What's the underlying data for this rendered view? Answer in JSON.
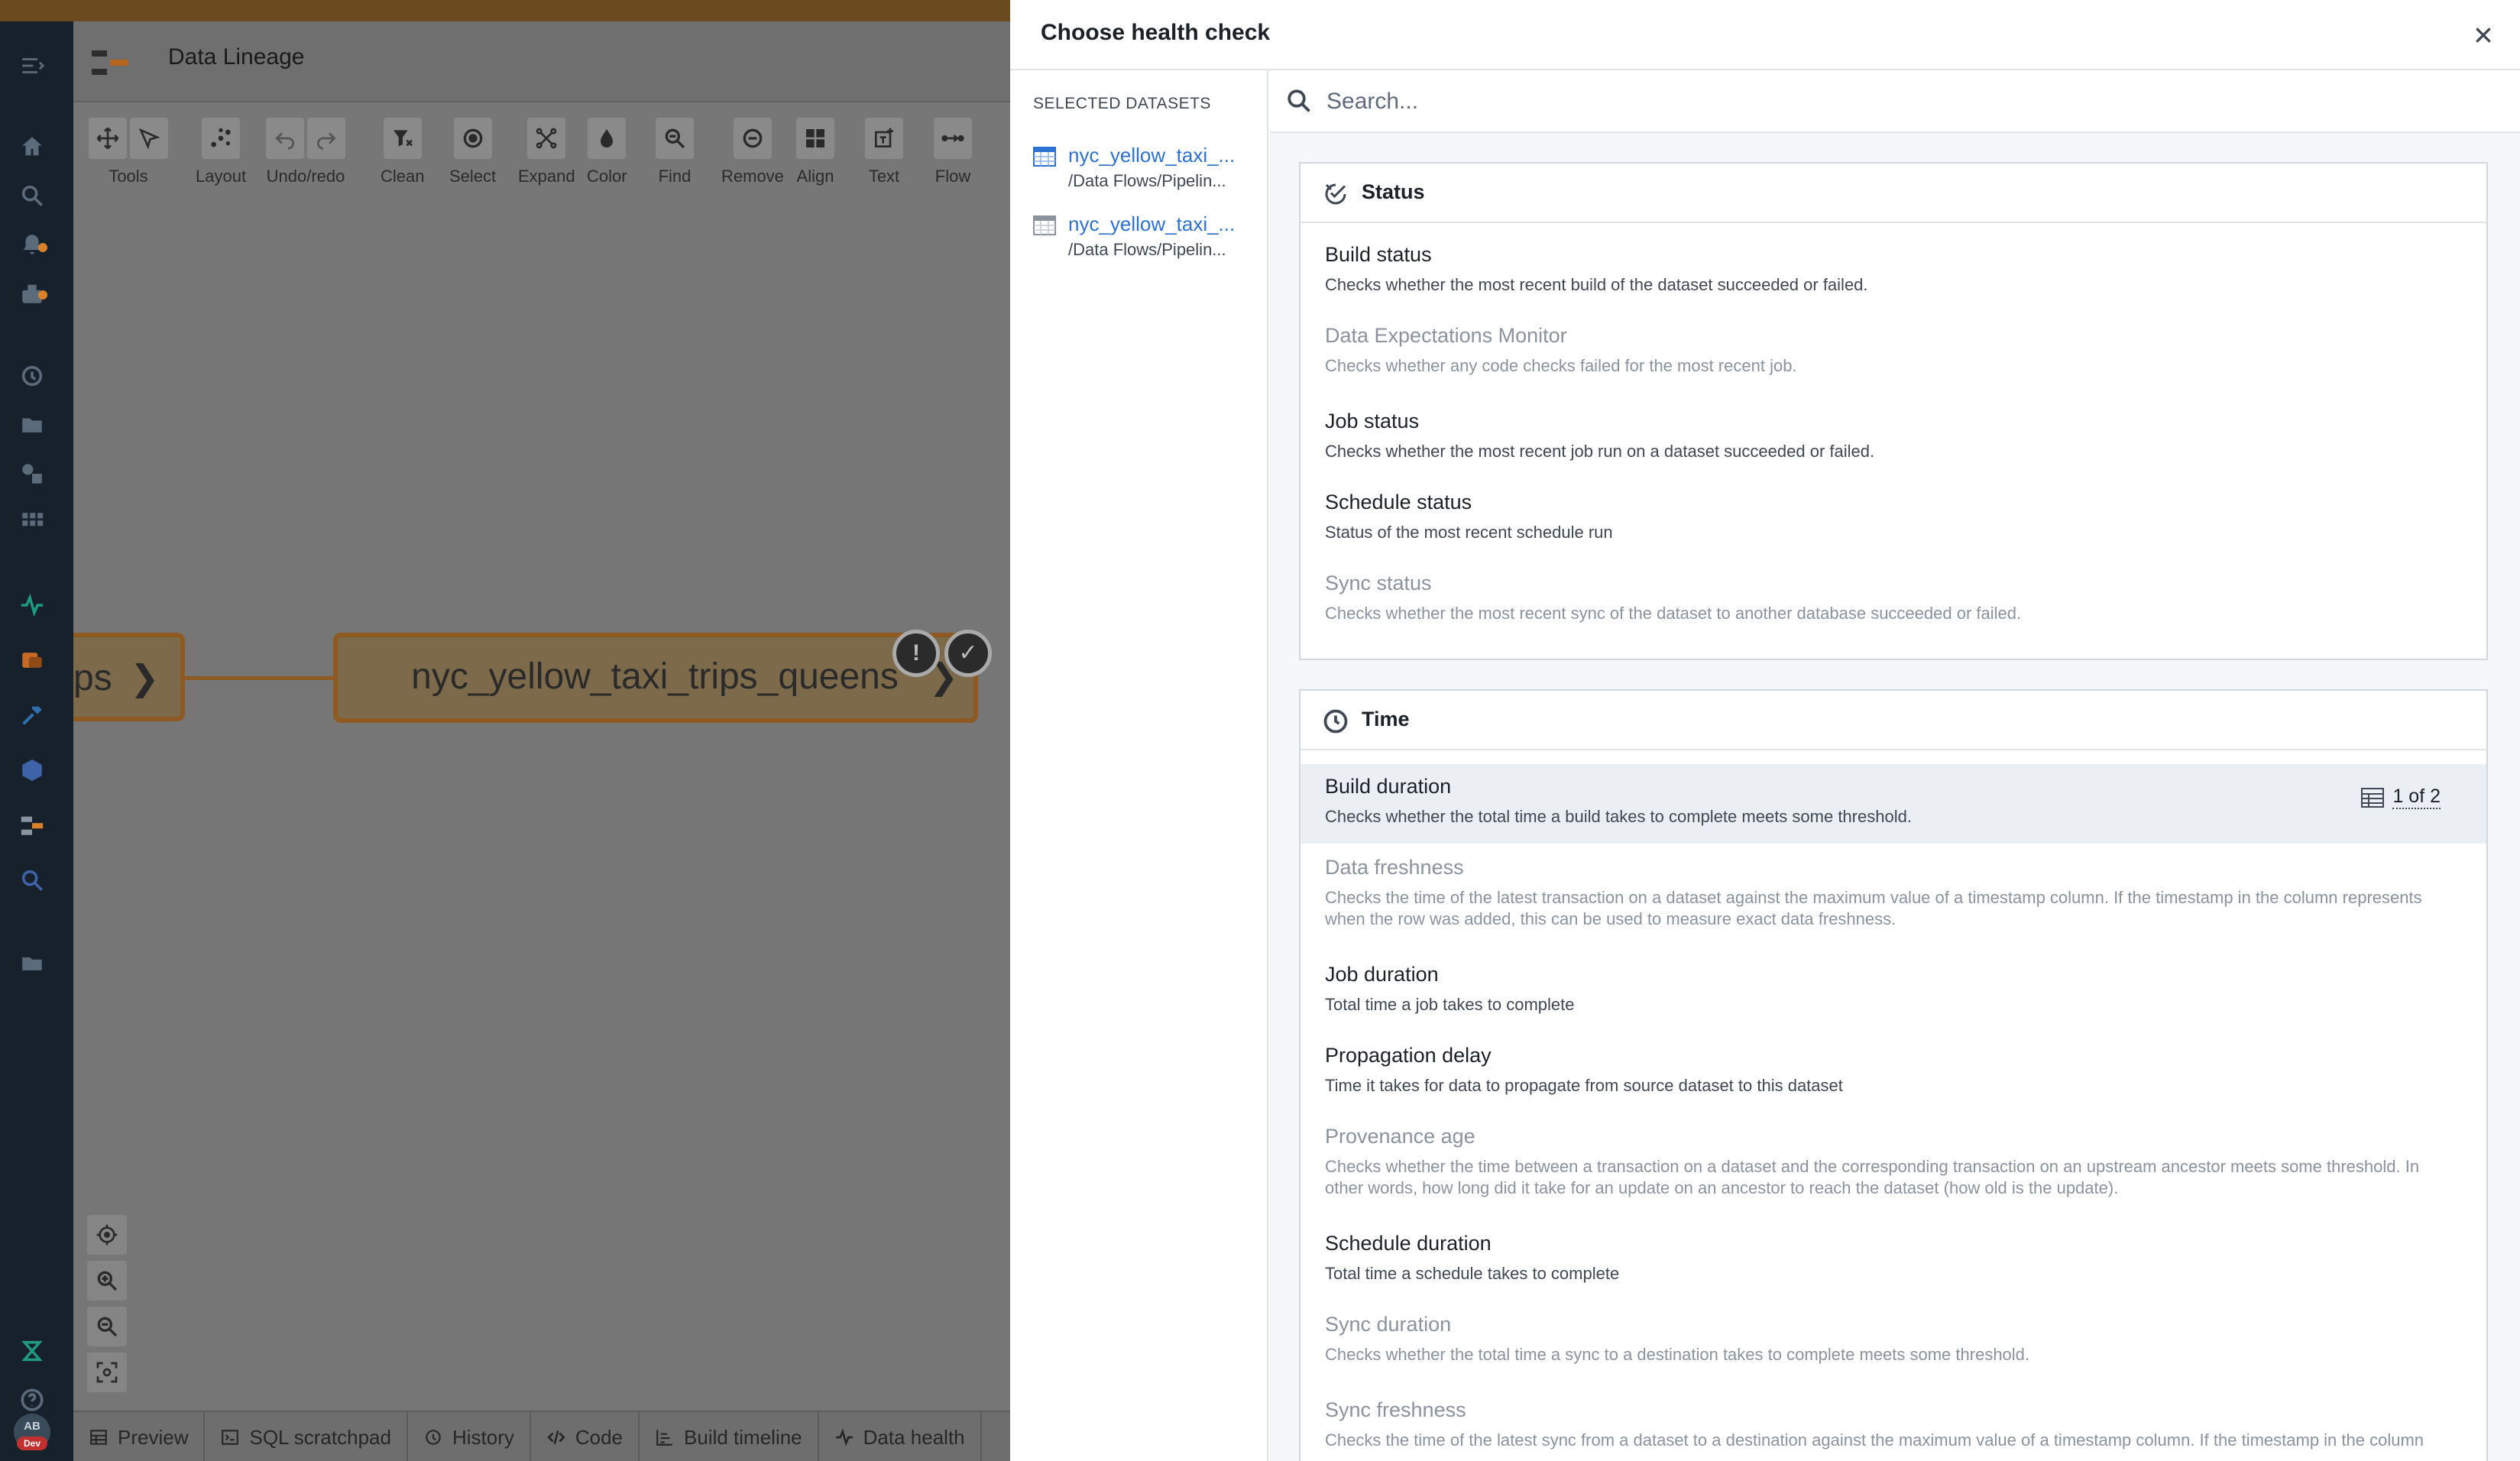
{
  "app": {
    "title": "Data Lineage"
  },
  "toolbar": [
    {
      "label": "Tools",
      "icon": "move-icon"
    },
    {
      "label": "Layout",
      "icon": "layout-icon"
    },
    {
      "label": "Undo/redo",
      "icon": "undo-icon"
    },
    {
      "label": "Clean",
      "icon": "clean-icon"
    },
    {
      "label": "Select",
      "icon": "select-icon"
    },
    {
      "label": "Expand",
      "icon": "expand-icon"
    },
    {
      "label": "Color",
      "icon": "color-icon"
    },
    {
      "label": "Find",
      "icon": "find-icon"
    },
    {
      "label": "Remove",
      "icon": "remove-icon"
    },
    {
      "label": "Align",
      "icon": "align-icon"
    },
    {
      "label": "Text",
      "icon": "text-icon"
    },
    {
      "label": "Flow",
      "icon": "flow-icon"
    }
  ],
  "graph": {
    "prev_node_label": "ps",
    "main_node_label": "nyc_yellow_taxi_trips_queens",
    "badge_warning": "!",
    "badge_ok": "✓",
    "edge_color": "#8f5a22"
  },
  "bottom_tabs": [
    {
      "label": "Preview"
    },
    {
      "label": "SQL scratchpad"
    },
    {
      "label": "History"
    },
    {
      "label": "Code"
    },
    {
      "label": "Build timeline"
    },
    {
      "label": "Data health"
    }
  ],
  "user": {
    "initials": "AB",
    "env": "Dev"
  },
  "drawer": {
    "title": "Choose health check",
    "selected_heading": "SELECTED DATASETS",
    "datasets": [
      {
        "name": "nyc_yellow_taxi_...",
        "path": "/Data Flows/Pipelin..."
      },
      {
        "name": "nyc_yellow_taxi_...",
        "path": "/Data Flows/Pipelin..."
      }
    ],
    "search_placeholder": "Search...",
    "sections": {
      "status": {
        "title": "Status",
        "checks": [
          {
            "name": "Build status",
            "desc": "Checks whether the most recent build of the dataset succeeded or failed."
          },
          {
            "name": "Data Expectations Monitor",
            "desc": "Checks whether any code checks failed for the most recent job."
          },
          {
            "name": "Job status",
            "desc": "Checks whether the most recent job run on a dataset succeeded or failed."
          },
          {
            "name": "Schedule status",
            "desc": "Status of the most recent schedule run"
          },
          {
            "name": "Sync status",
            "desc": "Checks whether the most recent sync of the dataset to another database succeeded or failed."
          }
        ]
      },
      "time": {
        "title": "Time",
        "checks": [
          {
            "name": "Build duration",
            "desc": "Checks whether the total time a build takes to complete meets some threshold.",
            "count": "1 of 2"
          },
          {
            "name": "Data freshness",
            "desc": "Checks the time of the latest transaction on a dataset against the maximum value of a timestamp column. If the timestamp in the column represents when the row was added, this can be used to measure exact data freshness."
          },
          {
            "name": "Job duration",
            "desc": "Total time a job takes to complete"
          },
          {
            "name": "Propagation delay",
            "desc": "Time it takes for data to propagate from source dataset to this dataset"
          },
          {
            "name": "Provenance age",
            "desc": "Checks whether the time between a transaction on a dataset and the corresponding transaction on an upstream ancestor meets some threshold. In other words, how long did it take for an update on an ancestor to reach the dataset (how old is the update)."
          },
          {
            "name": "Schedule duration",
            "desc": "Total time a schedule takes to complete"
          },
          {
            "name": "Sync duration",
            "desc": "Checks whether the total time a sync to a destination takes to complete meets some threshold."
          },
          {
            "name": "Sync freshness",
            "desc": "Checks the time of the latest sync from a dataset to a destination against the maximum value of a timestamp column. If the timestamp in the column"
          }
        ]
      }
    }
  }
}
